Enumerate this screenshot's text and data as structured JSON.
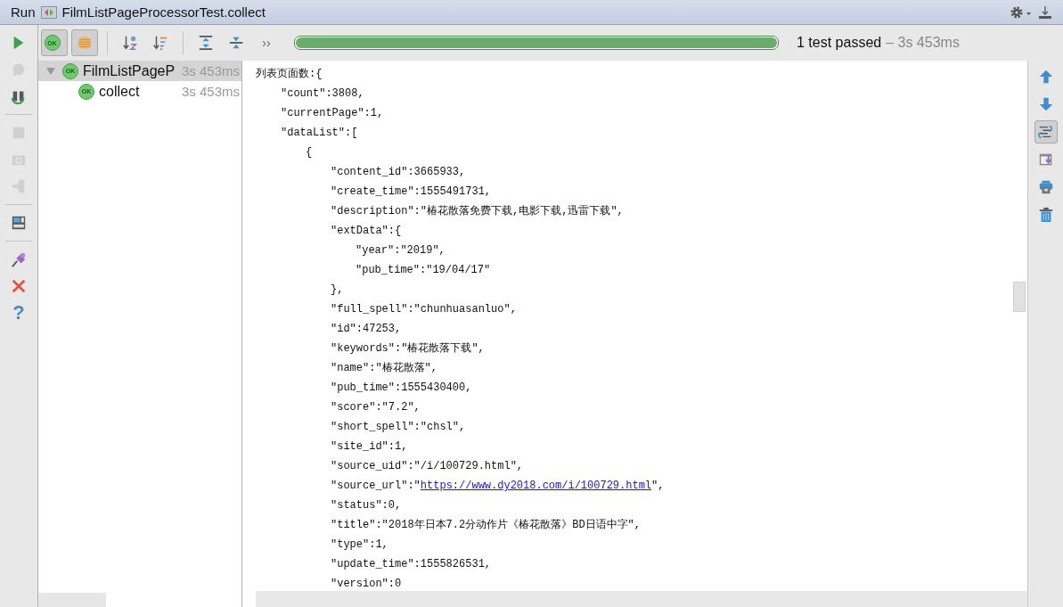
{
  "window": {
    "label": "Run",
    "title": "FilmListPageProcessorTest.collect"
  },
  "left_toolbar": [
    {
      "kind": "run",
      "disabled": false
    },
    {
      "kind": "debug",
      "disabled": true
    },
    {
      "kind": "rerun",
      "disabled": false
    },
    {
      "kind": "separator"
    },
    {
      "kind": "stop",
      "disabled": true
    },
    {
      "kind": "camera",
      "disabled": true
    },
    {
      "kind": "exit",
      "disabled": true
    },
    {
      "kind": "separator"
    },
    {
      "kind": "layout",
      "disabled": false
    },
    {
      "kind": "separator"
    },
    {
      "kind": "pin",
      "disabled": false
    },
    {
      "kind": "close",
      "disabled": false
    },
    {
      "kind": "help",
      "glyph": "?",
      "disabled": false
    }
  ],
  "top_toolbar": [
    {
      "kind": "show-passed",
      "badge": "OK",
      "pressed": true
    },
    {
      "kind": "show-ignored",
      "pressed": true
    },
    {
      "kind": "separator"
    },
    {
      "kind": "sort-alpha",
      "pressed": false
    },
    {
      "kind": "sort-duration",
      "pressed": false
    },
    {
      "kind": "separator"
    },
    {
      "kind": "expand-all",
      "pressed": false
    },
    {
      "kind": "collapse-all",
      "pressed": false
    },
    {
      "kind": "more",
      "glyph": "››",
      "pressed": false
    }
  ],
  "progress": {
    "level": 1
  },
  "status": {
    "result": "1 test passed",
    "duration": "– 3s 453ms"
  },
  "tree": {
    "items": [
      {
        "label": "FilmListPageP",
        "time": "3s 453ms",
        "badge": "OK",
        "expanded": true,
        "selected": true,
        "children": [
          {
            "label": "collect",
            "time": "3s 453ms",
            "badge": "OK",
            "selected": false
          }
        ]
      }
    ]
  },
  "console": {
    "lines": [
      {
        "text": "列表页面数:{",
        "children": [
          {
            "text": "\"count\":3808,"
          },
          {
            "text": "\"currentPage\":1,"
          },
          {
            "text": "\"dataList\":[",
            "children": [
              {
                "text": "{",
                "children": [
                  {
                    "text": "\"content_id\":3665933,"
                  },
                  {
                    "text": "\"create_time\":1555491731,"
                  },
                  {
                    "text": "\"description\":\"椿花散落免费下载,电影下载,迅雷下载\","
                  },
                  {
                    "text": "\"extData\":{",
                    "children": [
                      {
                        "text": "\"year\":\"2019\","
                      },
                      {
                        "text": "\"pub_time\":\"19/04/17\""
                      }
                    ]
                  },
                  {
                    "text": "},"
                  },
                  {
                    "text": "\"full_spell\":\"chunhuasanluo\","
                  },
                  {
                    "text": "\"id\":47253,"
                  },
                  {
                    "text": "\"keywords\":\"椿花散落下载\","
                  },
                  {
                    "text": "\"name\":\"椿花散落\","
                  },
                  {
                    "text": "\"pub_time\":1555430400,"
                  },
                  {
                    "text": "\"score\":\"7.2\","
                  },
                  {
                    "text": "\"short_spell\":\"chsl\","
                  },
                  {
                    "text": "\"site_id\":1,"
                  },
                  {
                    "text": "\"source_uid\":\"/i/100729.html\","
                  },
                  {
                    "text": "\"source_url\":\"",
                    "link": "https://www.dy2018.com/i/100729.html",
                    "after": "\","
                  },
                  {
                    "text": "\"status\":0,"
                  },
                  {
                    "text": "\"title\":\"2018年日本7.2分动作片《椿花散落》BD日语中字\","
                  },
                  {
                    "text": "\"type\":1,"
                  },
                  {
                    "text": "\"update_time\":1555826531,"
                  },
                  {
                    "text": "\"version\":0"
                  }
                ]
              }
            ]
          }
        ]
      }
    ]
  },
  "right_toolbar": [
    {
      "kind": "up",
      "pressed": false
    },
    {
      "kind": "down",
      "pressed": false
    },
    {
      "kind": "soft-wrap",
      "pressed": true
    },
    {
      "kind": "scroll-end",
      "pressed": false
    },
    {
      "kind": "print",
      "pressed": false
    },
    {
      "kind": "clear",
      "pressed": false
    }
  ]
}
